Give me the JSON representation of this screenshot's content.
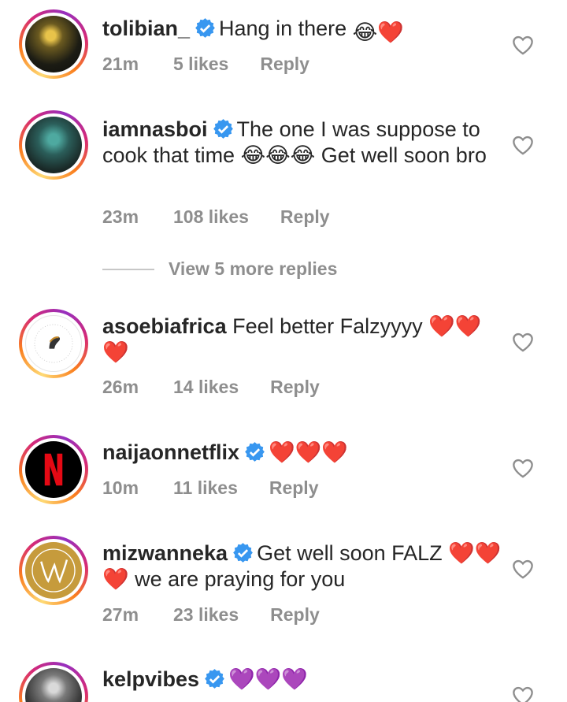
{
  "comments": [
    {
      "username": "tolibian_",
      "verified": true,
      "text": "Hang in there",
      "emojis": "😂❤️",
      "time": "21m",
      "likes": "5 likes",
      "reply": "Reply"
    },
    {
      "username": "iamnasboi",
      "verified": true,
      "text": "The one I was suppose to cook that time 😂😂😂 Get well soon bro",
      "time": "23m",
      "likes": "108 likes",
      "reply": "Reply"
    },
    {
      "username": "asoebiafrica",
      "verified": false,
      "text": "Feel better Falzyyyy ❤️❤️❤️",
      "time": "26m",
      "likes": "14 likes",
      "reply": "Reply"
    },
    {
      "username": "naijaonnetflix",
      "verified": true,
      "text": "❤️❤️❤️",
      "time": "10m",
      "likes": "11 likes",
      "reply": "Reply"
    },
    {
      "username": "mizwanneka",
      "verified": true,
      "text": "Get well soon FALZ ❤️❤️❤️ we are praying for you",
      "time": "27m",
      "likes": "23 likes",
      "reply": "Reply"
    },
    {
      "username": "kelpvibes",
      "verified": true,
      "text": "💜💜💜"
    }
  ],
  "view_replies": "View 5 more replies",
  "colors": {
    "verified": "#3897f0",
    "heart": "#ed1c24",
    "purple": "#8e2de2",
    "meta": "#8e8e8e"
  }
}
